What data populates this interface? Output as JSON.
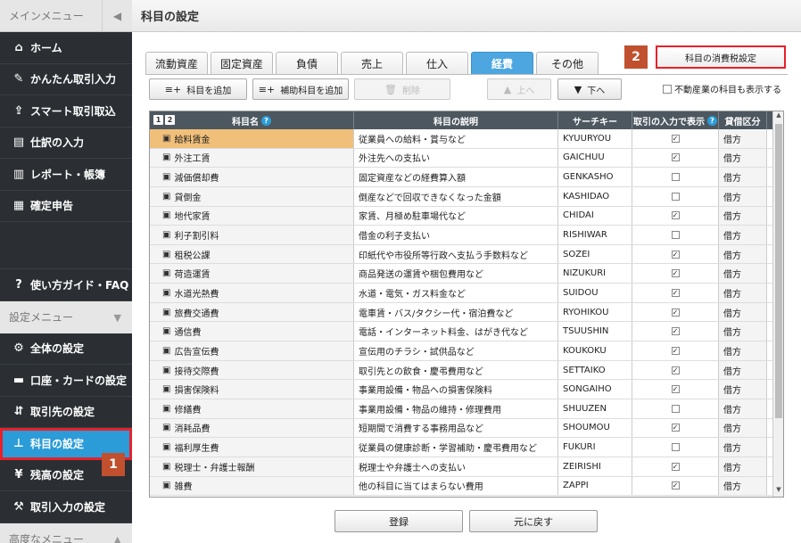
{
  "sidebar": {
    "header": "メインメニュー",
    "items": [
      {
        "label": "ホーム",
        "icon": "home-icon"
      },
      {
        "label": "かんたん取引入力",
        "icon": "pencil-icon"
      },
      {
        "label": "スマート取引取込",
        "icon": "import-icon"
      },
      {
        "label": "仕訳の入力",
        "icon": "journal-icon"
      },
      {
        "label": "レポート・帳簿",
        "icon": "report-icon"
      },
      {
        "label": "確定申告",
        "icon": "tax-return-icon"
      }
    ],
    "guide": "使い方ガイド・FAQ",
    "settings_header": "設定メニュー",
    "settings_items": [
      {
        "label": "全体の設定"
      },
      {
        "label": "口座・カードの設定"
      },
      {
        "label": "取引先の設定"
      },
      {
        "label": "科目の設定"
      },
      {
        "label": "残高の設定"
      },
      {
        "label": "取引入力の設定"
      }
    ],
    "advanced_header": "高度なメニュー"
  },
  "page": {
    "title": "科目の設定",
    "tax_button": "科目の消費税設定",
    "badge1": "1",
    "badge2": "2"
  },
  "tabs": [
    "流動資産",
    "固定資産",
    "負債",
    "売上",
    "仕入",
    "経費",
    "その他"
  ],
  "active_tab": "経費",
  "toolbar": {
    "add": "科目を追加",
    "add_sub": "補助科目を追加",
    "delete": "削除",
    "up": "上へ",
    "down": "下へ",
    "show_real_estate": "不動産業の科目も表示する"
  },
  "table": {
    "headers": {
      "name": "科目名",
      "desc": "科目の説明",
      "key": "サーチキー",
      "show": "取引の入力で表示",
      "side": "貸借区分",
      "level1": "1",
      "level2": "2"
    },
    "rows": [
      {
        "name": "給料賃金",
        "desc": "従業員への給料・賞与など",
        "key": "KYUURYOU",
        "show": true,
        "side": "借方"
      },
      {
        "name": "外注工賃",
        "desc": "外注先への支払い",
        "key": "GAICHUU",
        "show": true,
        "side": "借方"
      },
      {
        "name": "減価償却費",
        "desc": "固定資産などの経費算入額",
        "key": "GENKASHO",
        "show": false,
        "side": "借方"
      },
      {
        "name": "貸倒金",
        "desc": "倒産などで回収できなくなった金額",
        "key": "KASHIDAO",
        "show": false,
        "side": "借方"
      },
      {
        "name": "地代家賃",
        "desc": "家賃、月極め駐車場代など",
        "key": "CHIDAI",
        "show": true,
        "side": "借方"
      },
      {
        "name": "利子割引料",
        "desc": "借金の利子支払い",
        "key": "RISHIWAR",
        "show": false,
        "side": "借方"
      },
      {
        "name": "租税公課",
        "desc": "印紙代や市役所等行政へ支払う手数料など",
        "key": "SOZEI",
        "show": true,
        "side": "借方"
      },
      {
        "name": "荷造運賃",
        "desc": "商品発送の運賃や梱包費用など",
        "key": "NIZUKURI",
        "show": true,
        "side": "借方"
      },
      {
        "name": "水道光熱費",
        "desc": "水道・電気・ガス料金など",
        "key": "SUIDOU",
        "show": true,
        "side": "借方"
      },
      {
        "name": "旅費交通費",
        "desc": "電車賃・バス/タクシー代・宿泊費など",
        "key": "RYOHIKOU",
        "show": true,
        "side": "借方"
      },
      {
        "name": "通信費",
        "desc": "電話・インターネット料金、はがき代など",
        "key": "TSUUSHIN",
        "show": true,
        "side": "借方"
      },
      {
        "name": "広告宣伝費",
        "desc": "宣伝用のチラシ・試供品など",
        "key": "KOUKOKU",
        "show": true,
        "side": "借方"
      },
      {
        "name": "接待交際費",
        "desc": "取引先との飲食・慶弔費用など",
        "key": "SETTAIKO",
        "show": true,
        "side": "借方"
      },
      {
        "name": "損害保険料",
        "desc": "事業用設備・物品への損害保険料",
        "key": "SONGAIHO",
        "show": true,
        "side": "借方"
      },
      {
        "name": "修繕費",
        "desc": "事業用設備・物品の維持・修理費用",
        "key": "SHUUZEN",
        "show": false,
        "side": "借方"
      },
      {
        "name": "消耗品費",
        "desc": "短期間で消費する事務用品など",
        "key": "SHOUMOU",
        "show": true,
        "side": "借方"
      },
      {
        "name": "福利厚生費",
        "desc": "従業員の健康診断・学習補助・慶弔費用など",
        "key": "FUKURI",
        "show": false,
        "side": "借方"
      },
      {
        "name": "税理士・弁護士報酬",
        "desc": "税理士や弁護士への支払い",
        "key": "ZEIRISHI",
        "show": true,
        "side": "借方"
      },
      {
        "name": "雑費",
        "desc": "他の科目に当てはまらない費用",
        "key": "ZAPPI",
        "show": true,
        "side": "借方"
      }
    ]
  },
  "footer": {
    "save": "登録",
    "revert": "元に戻す"
  },
  "colors": {
    "accent": "#2b9cd8",
    "highlight_border": "#e8202a",
    "badge": "#c1502e",
    "selected_row": "#f0c07a"
  }
}
